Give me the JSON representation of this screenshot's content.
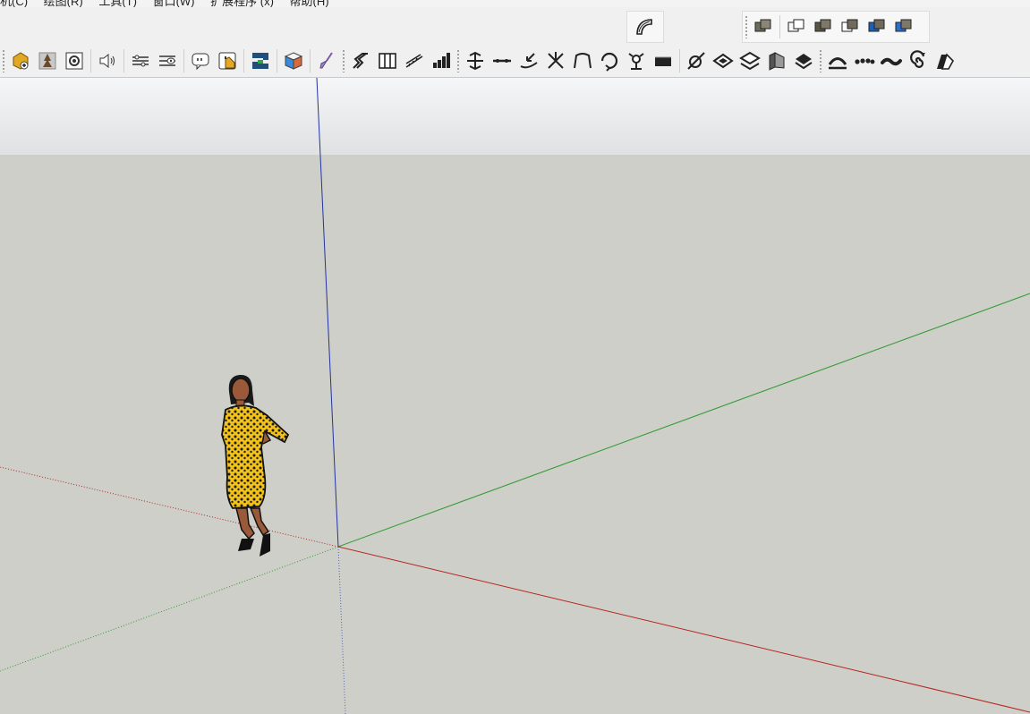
{
  "menu": {
    "items": [
      "机(C)",
      "绘图(R)",
      "工具(T)",
      "窗口(W)",
      "扩展程序 (x)",
      "帮助(H)"
    ]
  },
  "toolbar_top": {
    "left_panel": [
      {
        "icon": "follow-me-curve-icon"
      }
    ],
    "right_panel": [
      {
        "icon": "solid-union-icon"
      },
      {
        "icon": "solid-outer-shell-icon"
      },
      {
        "icon": "solid-intersect-icon"
      },
      {
        "icon": "solid-subtract-icon"
      },
      {
        "icon": "solid-trim-icon"
      },
      {
        "icon": "solid-split-icon"
      }
    ]
  },
  "toolbar_main": {
    "groups": [
      [
        "warehouse-add-icon",
        "3d-warehouse-icon",
        "extension-settings-icon"
      ],
      [
        "sound-icon"
      ],
      [
        "styles-settings-icon",
        "view-settings-icon"
      ],
      [
        "chat-icon",
        "info-icon"
      ],
      [
        "layout-icon"
      ],
      [
        "send-to-layout-cube-icon"
      ],
      [
        "cleanup-broom-icon"
      ],
      [
        "stair-tool-icon",
        "column-tool-icon",
        "ramp-icon",
        "bar-steps-icon"
      ],
      [
        "align-icon",
        "distribute-icon",
        "curve-arrow-icon",
        "explode-arrows-icon",
        "arch-icon",
        "rotate-arrow-icon",
        "gear-node-icon",
        "flat-plate-icon"
      ],
      [
        "circle-line-icon",
        "face-diamond-icon",
        "fold-faces-icon",
        "extrude-wall-icon",
        "roof-diamond-icon"
      ],
      [
        "arc-bridge-icon",
        "beads-icon",
        "wave-icon",
        "spiral-icon",
        "slope-surface-icon"
      ]
    ]
  },
  "viewport": {
    "sky_color": "#e6e8ea",
    "ground_color": "#cfcfca",
    "axis_colors": {
      "red": "#b5261e",
      "green": "#2f9a2f",
      "blue": "#2233a0"
    },
    "figure": "person-scale-figure"
  }
}
